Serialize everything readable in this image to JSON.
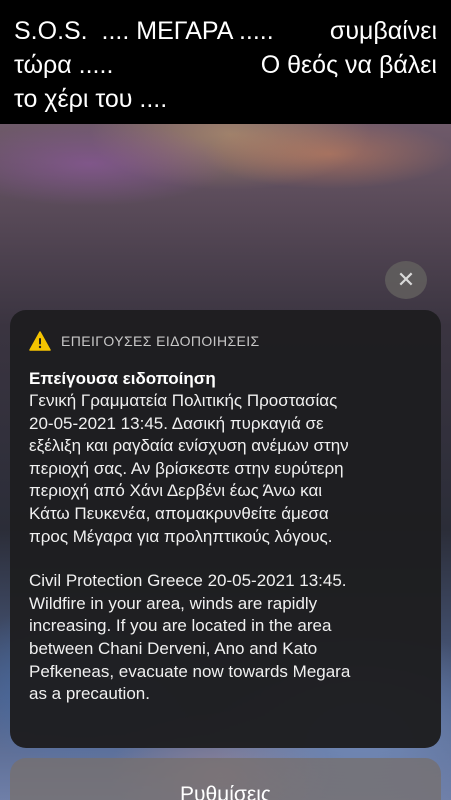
{
  "caption": {
    "line1_left": "S.O.S.  .... ΜΕΓΑΡΑ .....",
    "line1_right": "συμβαίνει",
    "line2_left": "τώρα .....",
    "line2_right": "Ο θεός να βάλει",
    "line3": "το χέρι του ...."
  },
  "close_icon": "✕",
  "alert": {
    "warning_icon": "warning-triangle-icon",
    "header": "ΕΠΕΙΓΟΥΣΕΣ ΕΙΔΟΠΟΙΗΣΕΙΣ",
    "title": "Επείγουσα ειδοποίηση",
    "greek_lines": [
      "Γενική Γραμματεία Πολιτικής Προστασίας",
      "20-05-2021 13:45. Δασική πυρκαγιά σε",
      "εξέλιξη και ραγδαία ενίσχυση ανέμων στην",
      "περιοχή σας. Αν βρίσκεστε στην ευρύτερη",
      "περιοχή από Χάνι Δερβένι έως Άνω και",
      "Κάτω Πευκενέα, απομακρυνθείτε άμεσα",
      "προς Μέγαρα για προληπτικούς λόγους."
    ],
    "english_lines": [
      "Civil Protection Greece 20-05-2021 13:45.",
      "Wildfire in your area, winds are rapidly",
      "increasing. If you are located in the area",
      "between Chani Derveni, Ano and Kato",
      "Pefkeneas, evacuate now towards Megara",
      "as a precaution."
    ]
  },
  "settings_button": "Ρυθμίσεις",
  "colors": {
    "warning": "#f5c400",
    "card": "#1e1e20",
    "button": "#76706e"
  }
}
